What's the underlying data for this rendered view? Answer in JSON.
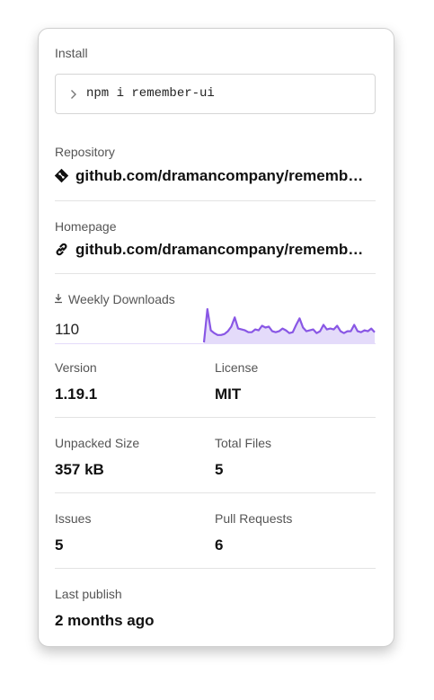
{
  "install": {
    "label": "Install",
    "command": "npm i remember-ui"
  },
  "repository": {
    "label": "Repository",
    "url": "github.com/dramancompany/remembe…"
  },
  "homepage": {
    "label": "Homepage",
    "url": "github.com/dramancompany/remembe…"
  },
  "downloads": {
    "label": "Weekly Downloads",
    "value": "110",
    "sparkline": [
      1,
      37,
      14,
      11,
      9,
      9,
      10,
      13,
      18,
      28,
      16,
      15,
      14,
      12,
      12,
      15,
      14,
      19,
      17,
      18,
      13,
      12,
      13,
      16,
      14,
      11,
      12,
      20,
      27,
      17,
      13,
      14,
      15,
      11,
      13,
      20,
      15,
      16,
      15,
      19,
      13,
      11,
      13,
      13,
      20,
      13,
      12,
      14,
      13,
      16,
      12
    ],
    "color": "#8957e5",
    "fill": "#e4dbfa"
  },
  "version": {
    "label": "Version",
    "value": "1.19.1"
  },
  "license": {
    "label": "License",
    "value": "MIT"
  },
  "unpacked_size": {
    "label": "Unpacked Size",
    "value": "357 kB"
  },
  "total_files": {
    "label": "Total Files",
    "value": "5"
  },
  "issues": {
    "label": "Issues",
    "value": "5"
  },
  "pull_requests": {
    "label": "Pull Requests",
    "value": "6"
  },
  "last_publish": {
    "label": "Last publish",
    "value": "2 months ago"
  }
}
